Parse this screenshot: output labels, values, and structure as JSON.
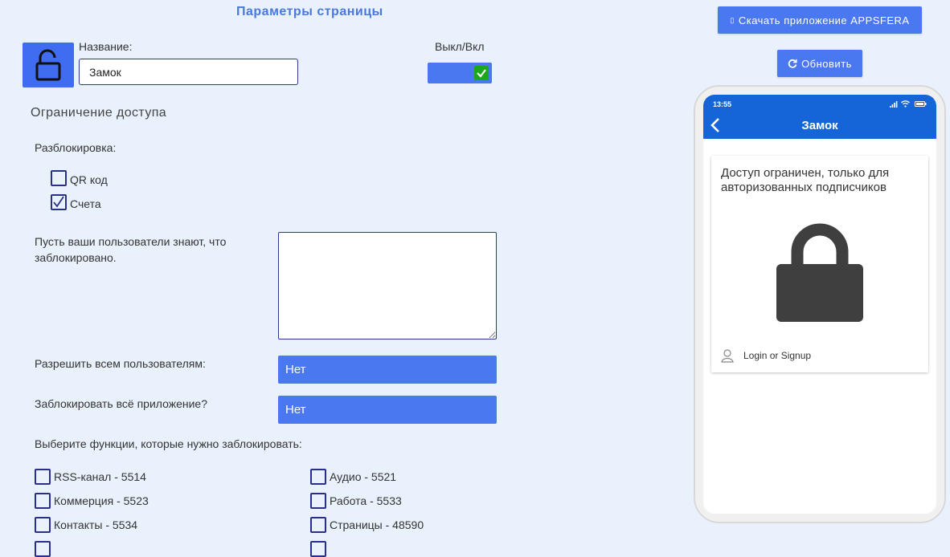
{
  "page_title": "Параметры страницы",
  "name_label": "Название:",
  "name_value": "Замок",
  "toggle_label": "Выкл/Вкл",
  "toggle_on": true,
  "access_title": "Ограничение доступа",
  "unlock_label": "Разблокировка:",
  "unlock_options": [
    {
      "label": "QR код",
      "checked": false
    },
    {
      "label": "Счета",
      "checked": true
    }
  ],
  "message_label": "Пусть ваши пользователи знают, что заблокировано.",
  "message_value": "",
  "allow_all_label": "Разрешить всем пользователям:",
  "allow_all_value": "Нет",
  "lock_app_label": "Заблокировать всё приложение?",
  "lock_app_value": "Нет",
  "features_label": "Выберите функции, которые нужно заблокировать:",
  "features": [
    {
      "label": "RSS-канал - 5514",
      "checked": false
    },
    {
      "label": "Аудио - 5521",
      "checked": false
    },
    {
      "label": "Коммерция - 5523",
      "checked": false
    },
    {
      "label": "Работа - 5533",
      "checked": false
    },
    {
      "label": "Контакты - 5534",
      "checked": false
    },
    {
      "label": "Страницы - 48590",
      "checked": false
    }
  ],
  "download_button": "Скачать приложение APPSFERA",
  "refresh_button": "Обновить",
  "preview": {
    "time": "13:55",
    "title": "Замок",
    "message": "Доступ ограничен, только для авторизованных подписчиков",
    "login_text": "Login or Signup"
  },
  "colors": {
    "accent": "#4a78f0",
    "nav": "#1565d8",
    "toggle_check": "#1ca81c",
    "background": "#e8f1fc"
  },
  "icons": [
    "lock-open-icon",
    "check-icon",
    "refresh-icon",
    "back-chevron-icon",
    "lock-icon",
    "user-icon",
    "signal-icon",
    "wifi-icon",
    "battery-icon"
  ]
}
